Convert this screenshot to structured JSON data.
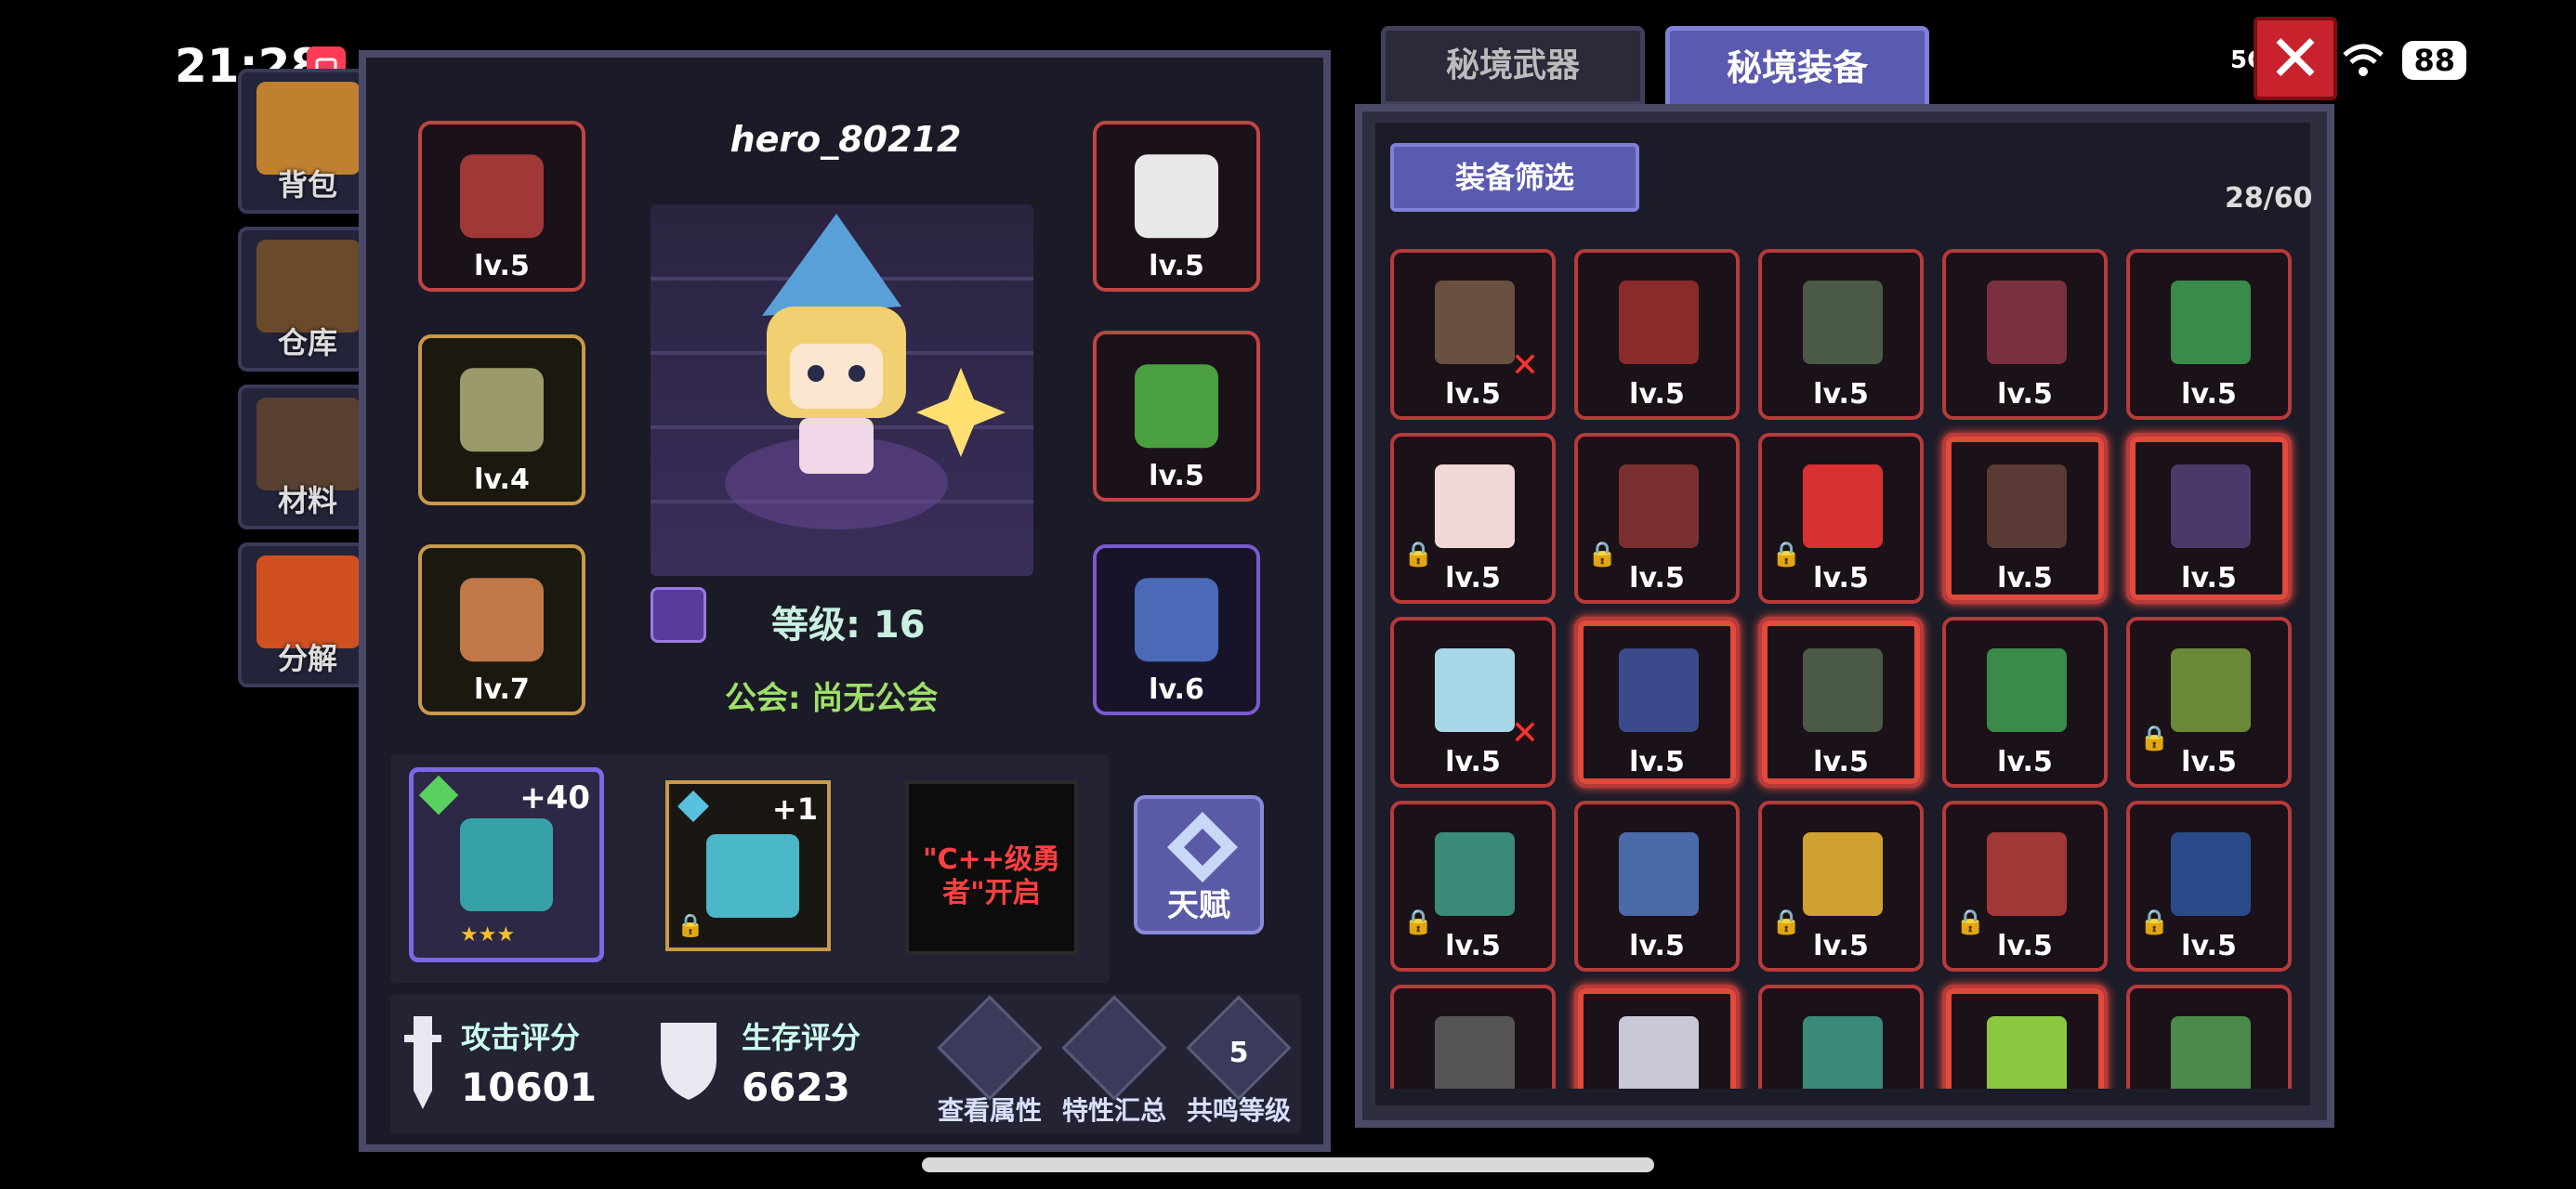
{
  "status": {
    "time": "21:28",
    "dots": "···",
    "net": "5G",
    "battery": "88"
  },
  "side_menu": [
    {
      "label": "背包",
      "color": "#c08030"
    },
    {
      "label": "仓库",
      "color": "#6a4a2a"
    },
    {
      "label": "材料",
      "color": "#5a4030"
    },
    {
      "label": "分解",
      "color": "#d05020"
    }
  ],
  "hero": {
    "name": "hero_80212",
    "level": "等级: 16",
    "guild": "公会: 尚无公会"
  },
  "left_slots": [
    {
      "lv": "lv.5",
      "style": "red",
      "color": "#a03838"
    },
    {
      "lv": "lv.4",
      "style": "gold",
      "color": "#9a9a6a"
    },
    {
      "lv": "lv.7",
      "style": "gold",
      "color": "#c07848"
    }
  ],
  "right_slots": [
    {
      "lv": "lv.5",
      "style": "red",
      "color": "#e8e8e8"
    },
    {
      "lv": "lv.5",
      "style": "red",
      "color": "#4aa040"
    },
    {
      "lv": "lv.6",
      "style": "purple",
      "color": "#4a6ab8"
    }
  ],
  "cards": {
    "weapon_plus": "+40",
    "pet_plus": "+1",
    "locked_msg": "\"C++级勇者\"开启",
    "talent": "天赋"
  },
  "scores": {
    "attack_label": "攻击评分",
    "attack_value": "10601",
    "survive_label": "生存评分",
    "survive_value": "6623",
    "btn_attr": "查看属性",
    "btn_trait": "特性汇总",
    "btn_resonance": "共鸣等级",
    "resonance_num": "5"
  },
  "tabs": {
    "weapon": "秘境武器",
    "equip": "秘境装备"
  },
  "inventory": {
    "filter": "装备筛选",
    "count": "28/60",
    "items": [
      {
        "lv": "lv.5",
        "color": "#6a5040",
        "glow": false,
        "lock": false,
        "x": true
      },
      {
        "lv": "lv.5",
        "color": "#8a2a2a",
        "glow": false,
        "lock": false,
        "x": false
      },
      {
        "lv": "lv.5",
        "color": "#4a5a44",
        "glow": false,
        "lock": false,
        "x": false
      },
      {
        "lv": "lv.5",
        "color": "#7a3040",
        "glow": false,
        "lock": false,
        "x": false
      },
      {
        "lv": "lv.5",
        "color": "#3a8a4a",
        "glow": false,
        "lock": false,
        "x": false
      },
      {
        "lv": "lv.5",
        "color": "#f0d8d8",
        "glow": false,
        "lock": true,
        "x": false
      },
      {
        "lv": "lv.5",
        "color": "#7a3030",
        "glow": false,
        "lock": true,
        "x": false
      },
      {
        "lv": "lv.5",
        "color": "#d83030",
        "glow": false,
        "lock": true,
        "x": false
      },
      {
        "lv": "lv.5",
        "color": "#5a3a34",
        "glow": true,
        "lock": false,
        "x": false
      },
      {
        "lv": "lv.5",
        "color": "#4a3a6a",
        "glow": true,
        "lock": false,
        "x": false
      },
      {
        "lv": "lv.5",
        "color": "#a8d8e8",
        "glow": false,
        "lock": false,
        "x": true
      },
      {
        "lv": "lv.5",
        "color": "#3a4a8a",
        "glow": true,
        "lock": false,
        "x": false
      },
      {
        "lv": "lv.5",
        "color": "#4a5a44",
        "glow": true,
        "lock": false,
        "x": false
      },
      {
        "lv": "lv.5",
        "color": "#3a8a4a",
        "glow": false,
        "lock": false,
        "x": false
      },
      {
        "lv": "lv.5",
        "color": "#6a8a3a",
        "glow": false,
        "lock": true,
        "x": false
      },
      {
        "lv": "lv.5",
        "color": "#3a8a7a",
        "glow": false,
        "lock": true,
        "x": false
      },
      {
        "lv": "lv.5",
        "color": "#4a6aa8",
        "glow": false,
        "lock": false,
        "x": false
      },
      {
        "lv": "lv.5",
        "color": "#d0a030",
        "glow": false,
        "lock": true,
        "x": false
      },
      {
        "lv": "lv.5",
        "color": "#a03838",
        "glow": false,
        "lock": true,
        "x": false
      },
      {
        "lv": "lv.5",
        "color": "#2a4a8a",
        "glow": false,
        "lock": true,
        "x": false
      },
      {
        "lv": "",
        "color": "#555555",
        "glow": false,
        "lock": false,
        "x": false
      },
      {
        "lv": "",
        "color": "#c8c8d8",
        "glow": true,
        "lock": false,
        "x": false
      },
      {
        "lv": "",
        "color": "#3a8a7a",
        "glow": false,
        "lock": false,
        "x": false
      },
      {
        "lv": "",
        "color": "#8ac840",
        "glow": true,
        "lock": false,
        "x": false
      },
      {
        "lv": "",
        "color": "#4a8a4a",
        "glow": false,
        "lock": false,
        "x": false
      }
    ]
  }
}
